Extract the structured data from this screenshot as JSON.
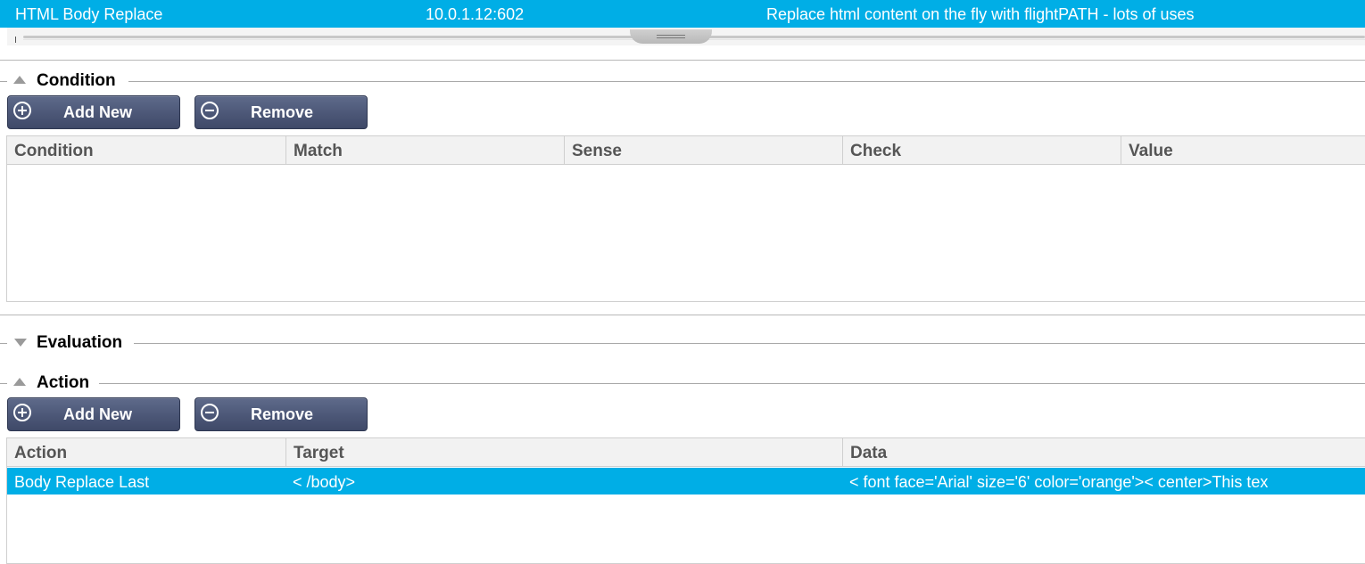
{
  "service_row": {
    "name": "HTML Body Replace",
    "address": "10.0.1.12:602",
    "description": "Replace html content on the fly with flightPATH - lots of uses"
  },
  "sections": {
    "condition": {
      "title": "Condition",
      "add_label": "Add New",
      "remove_label": "Remove",
      "columns": [
        "Condition",
        "Match",
        "Sense",
        "Check",
        "Value"
      ]
    },
    "evaluation": {
      "title": "Evaluation"
    },
    "action": {
      "title": "Action",
      "add_label": "Add New",
      "remove_label": "Remove",
      "columns": [
        "Action",
        "Target",
        "Data"
      ],
      "rows": [
        {
          "action": "Body Replace Last",
          "target": "< /body>",
          "data": "< font face='Arial' size='6' color='orange'>< center>This tex"
        }
      ]
    }
  },
  "icons": {
    "condition_toggle": "triangle-up-icon",
    "evaluation_toggle": "triangle-down-icon",
    "action_toggle": "triangle-up-icon",
    "add": "plus-circle-icon",
    "remove": "minus-circle-icon"
  },
  "colors": {
    "selection": "#00aee6",
    "button": "#4c5777"
  }
}
